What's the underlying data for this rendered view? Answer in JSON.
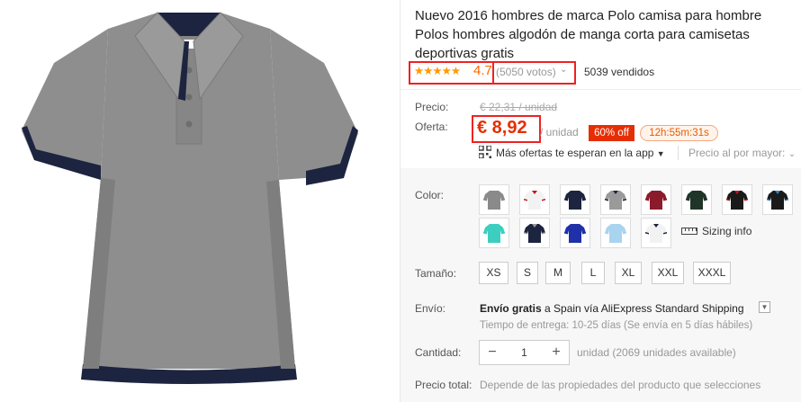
{
  "product": {
    "title": "Nuevo 2016 hombres de marca Polo camisa para hombre Polos hombres algodón de manga corta para camisetas deportivas gratis",
    "image_description_icon": "polo-shirt-image"
  },
  "rating": {
    "stars": "★★★★★",
    "value": "4.7",
    "votes": "(5050 votos)",
    "sold": "5039 vendidos"
  },
  "price": {
    "label": "Precio:",
    "original": "€ 22,31 / unidad",
    "offer_label": "Oferta:",
    "offer": "€ 8,92",
    "unit": "/ unidad",
    "discount": "60% off",
    "timer": "12h:55m:31s"
  },
  "offers": {
    "app_text": "Más ofertas te esperan en la app",
    "wholesale": "Precio al por mayor:"
  },
  "color": {
    "label": "Color:",
    "sizing_info": "Sizing info",
    "swatches": [
      {
        "name": "gray",
        "body": "#8a8a8a",
        "trim": "#8a8a8a"
      },
      {
        "name": "white-red",
        "body": "#f2f2f2",
        "trim": "#c0151f"
      },
      {
        "name": "navy",
        "body": "#1c2440",
        "trim": "#1c2440"
      },
      {
        "name": "gray-navy",
        "body": "#9a9a9a",
        "trim": "#1c2440"
      },
      {
        "name": "burgundy",
        "body": "#8b1a2a",
        "trim": "#8b1a2a"
      },
      {
        "name": "dark-green",
        "body": "#1f3528",
        "trim": "#1f3528"
      },
      {
        "name": "black-red",
        "body": "#1a1a1a",
        "trim": "#c0151f"
      },
      {
        "name": "black-blue",
        "body": "#1a1a1a",
        "trim": "#2a7fd0"
      },
      {
        "name": "turquoise",
        "body": "#3ccfbf",
        "trim": "#3ccfbf"
      },
      {
        "name": "navy-gray",
        "body": "#1c2440",
        "trim": "#999999"
      },
      {
        "name": "royal-blue",
        "body": "#2030a8",
        "trim": "#2030a8"
      },
      {
        "name": "light-blue",
        "body": "#a9d4f0",
        "trim": "#a9d4f0"
      },
      {
        "name": "white-navy",
        "body": "#f2f2f2",
        "trim": "#1c2440"
      }
    ]
  },
  "size": {
    "label": "Tamaño:",
    "options": [
      "XS",
      "S",
      "M",
      "L",
      "XL",
      "XXL",
      "XXXL"
    ]
  },
  "shipping": {
    "label": "Envío:",
    "free": "Envío gratis",
    "rest": " a Spain vía AliExpress Standard Shipping",
    "delivery": "Tiempo de entrega: 10-25 días (Se envía en 5 días hábiles)"
  },
  "quantity": {
    "label": "Cantidad:",
    "minus": "−",
    "value": "1",
    "plus": "+",
    "available": "unidad (2069 unidades available)"
  },
  "total": {
    "label": "Precio total:",
    "note": "Depende de las propiedades del producto que selecciones"
  },
  "colors": {
    "accent": "#e62e04",
    "star": "#ff9900",
    "highlight_box": "#ee2222",
    "shirt": "#8e8e8e",
    "shirt_trim": "#1c2440"
  }
}
